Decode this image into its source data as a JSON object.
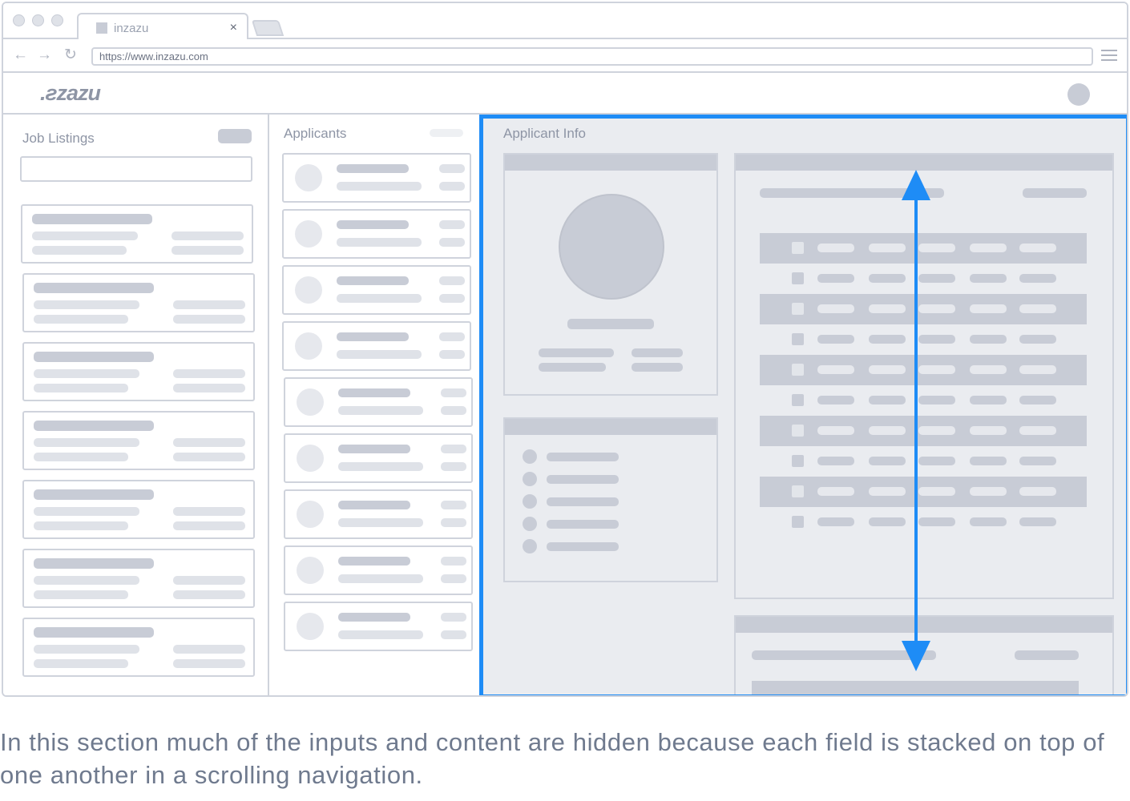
{
  "browser": {
    "tab_title": "inzazu",
    "tab_close": "×",
    "url": "https://www.inzazu.com",
    "nav_back": "←",
    "nav_forward": "→",
    "nav_reload": "↻"
  },
  "app": {
    "logo": ".ƨzazu"
  },
  "job_listings": {
    "title": "Job Listings"
  },
  "applicants": {
    "title": "Applicants"
  },
  "applicant_info": {
    "title": "Applicant Info"
  },
  "caption": "In this section much of the inputs and content are hidden because each field is stacked on top of one another in a scrolling navigation.",
  "colors": {
    "highlight": "#1e8cf6",
    "placeholder": "#c8ccd6",
    "placeholder_light": "#dfe2e8",
    "panel_bg": "#eaecf0"
  },
  "icons": [
    "back-arrow-icon",
    "forward-arrow-icon",
    "reload-icon",
    "menu-icon",
    "close-icon",
    "favicon-icon",
    "scroll-arrow-icon"
  ]
}
